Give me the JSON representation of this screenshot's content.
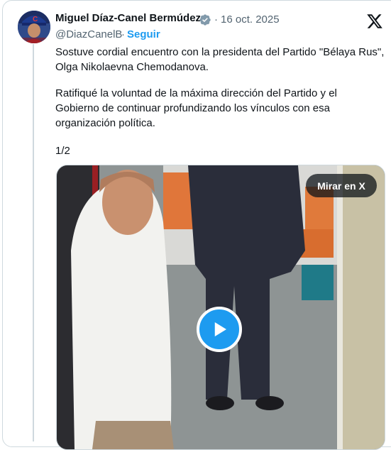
{
  "author": {
    "name": "Miguel Díaz-Canel Bermúdez",
    "handle": "@DiazCanelB",
    "separator": "·",
    "follow_label": "Seguir",
    "verified_icon": "verified-badge-icon"
  },
  "post": {
    "date": "16 oct. 2025",
    "paragraph1_line1": "Sostuve cordial encuentro con la presidenta del Partido \"Bélaya Rus\",",
    "paragraph1_line2": "Olga Nikolaevna Chemodanova.",
    "paragraph2_line1": "Ratifiqué la voluntad de la máxima dirección del Partido y el",
    "paragraph2_line2": "Gobierno de continuar profundizando los vínculos con esa",
    "paragraph2_line3": "organización política.",
    "paragraph3": "1/2"
  },
  "media": {
    "watch_label": "Mirar en X",
    "play_icon": "play-icon"
  },
  "colors": {
    "accent": "#1d9bf0",
    "text": "#0f1419",
    "secondary": "#536471",
    "border": "#cfd9de"
  }
}
